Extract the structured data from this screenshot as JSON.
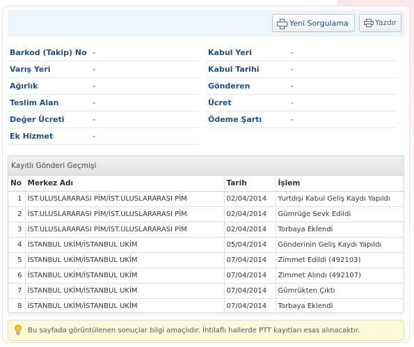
{
  "toolbar": {
    "new_query_label": "Yeni Sorgulama",
    "print_label": "Yazdır"
  },
  "info": {
    "left": [
      {
        "label": "Barkod (Takip) No",
        "value": "-"
      },
      {
        "label": "Varış Yeri",
        "value": "-"
      },
      {
        "label": "Ağırlık",
        "value": "-"
      },
      {
        "label": "Teslim Alan",
        "value": "-"
      },
      {
        "label": "Değer Ücreti",
        "value": "-"
      },
      {
        "label": "Ek Hizmet",
        "value": "-"
      }
    ],
    "right": [
      {
        "label": "Kabul Yeri",
        "value": "-"
      },
      {
        "label": "Kabul Tarihi",
        "value": "-"
      },
      {
        "label": "Gönderen",
        "value": "-"
      },
      {
        "label": "Ücret",
        "value": "-"
      },
      {
        "label": "Ödeme Şartı",
        "value": "-"
      }
    ]
  },
  "history": {
    "title": "Kayıtlı Gönderi Geçmişi",
    "columns": [
      "No",
      "Merkez Adı",
      "Tarih",
      "İşlem"
    ],
    "rows": [
      {
        "no": "1",
        "center": "İST.ULUSLARARASI PİM/İST.ULUSLARARASI PİM",
        "date": "02/04/2014",
        "action": "Yurtdışı Kabul Geliş Kaydı Yapıldı"
      },
      {
        "no": "2",
        "center": "İST.ULUSLARARASI PİM/İST.ULUSLARARASI PİM",
        "date": "02/04/2014",
        "action": "Gümrüğe Sevk Edildi"
      },
      {
        "no": "3",
        "center": "İST.ULUSLARARASI PİM/İST.ULUSLARARASI PİM",
        "date": "02/04/2014",
        "action": "Torbaya Eklendi"
      },
      {
        "no": "4",
        "center": "İSTANBUL UKİM/İSTANBUL UKİM",
        "date": "05/04/2014",
        "action": "Gönderinin Geliş Kaydı Yapıldı"
      },
      {
        "no": "5",
        "center": "İSTANBUL UKİM/İSTANBUL UKİM",
        "date": "07/04/2014",
        "action": "Zimmet Edildi (492103)"
      },
      {
        "no": "6",
        "center": "İSTANBUL UKİM/İSTANBUL UKİM",
        "date": "07/04/2014",
        "action": "Zimmet Alındı (492107)"
      },
      {
        "no": "7",
        "center": "İSTANBUL UKİM/İSTANBUL UKİM",
        "date": "07/04/2014",
        "action": "Gümrükten Çıktı"
      },
      {
        "no": "8",
        "center": "İSTANBUL UKİM/İSTANBUL UKİM",
        "date": "07/04/2014",
        "action": "Torbaya Eklendi"
      }
    ]
  },
  "notice": {
    "text": "Bu sayfada görüntülenen sonuçlar bilgi amaçlıdır. İhtilaflı hallerde PTT kayıtları esas alınacaktır."
  },
  "icons": {
    "new_query": "plus-icon",
    "print": "printer-icon",
    "notice": "lightbulb-icon"
  },
  "colors": {
    "label": "#1f4f86",
    "toolbar_bg": "#eef5fa",
    "notice_bg": "#fdf9d9"
  }
}
